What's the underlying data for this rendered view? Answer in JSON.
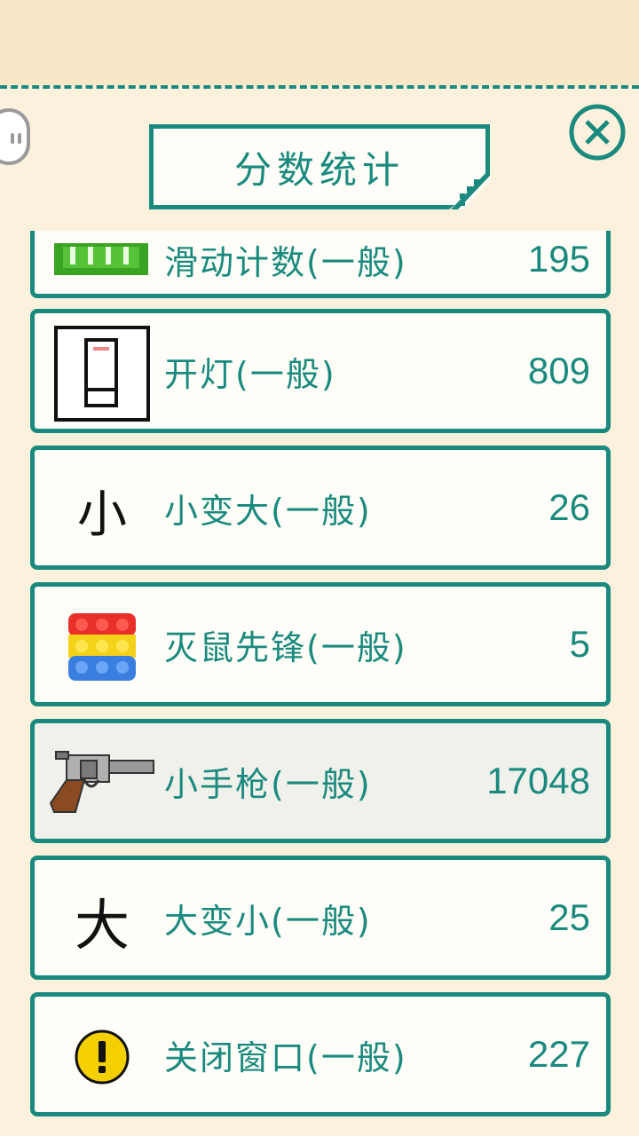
{
  "header": {
    "title": "分数统计",
    "close_icon": "close-x-circle-icon",
    "side_toggle_icon": "pause-toggle-icon"
  },
  "colors": {
    "accent": "#1a8a7e",
    "background": "#f8e8c8",
    "card": "#fffdf7"
  },
  "stats": [
    {
      "icon": "green-grid-icon",
      "label": "滑动计数(一般)",
      "value": "195"
    },
    {
      "icon": "light-switch-icon",
      "label": "开灯(一般)",
      "value": "809"
    },
    {
      "icon": "small-char-icon",
      "glyph": "小",
      "label": "小变大(一般)",
      "value": "26"
    },
    {
      "icon": "pop-it-toy-icon",
      "label": "灭鼠先锋(一般)",
      "value": "5"
    },
    {
      "icon": "revolver-icon",
      "label": "小手枪(一般)",
      "value": "17048"
    },
    {
      "icon": "big-char-icon",
      "glyph": "大",
      "label": "大变小(一般)",
      "value": "25"
    },
    {
      "icon": "warning-icon",
      "label": "关闭窗口(一般)",
      "value": "227"
    }
  ]
}
